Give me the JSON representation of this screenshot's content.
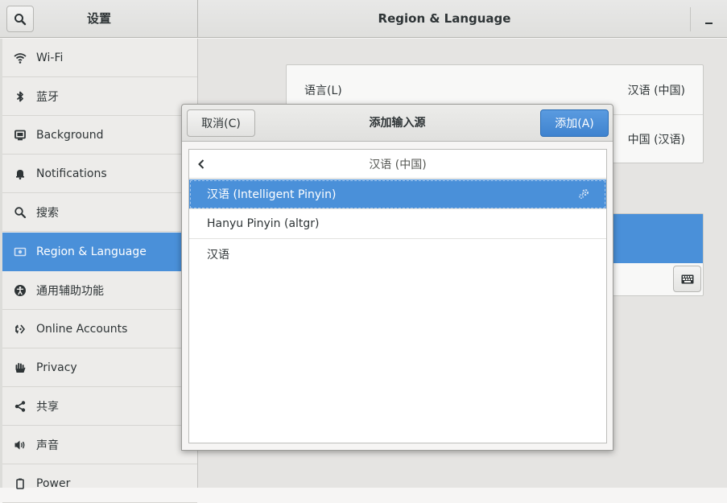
{
  "header": {
    "settings_title": "设置",
    "panel_title": "Region & Language"
  },
  "sidebar": {
    "items": [
      {
        "label": "Wi-Fi",
        "icon": "wifi-icon"
      },
      {
        "label": "蓝牙",
        "icon": "bluetooth-icon"
      },
      {
        "label": "Background",
        "icon": "display-icon"
      },
      {
        "label": "Notifications",
        "icon": "bell-icon"
      },
      {
        "label": "搜索",
        "icon": "search-icon"
      },
      {
        "label": "Region & Language",
        "icon": "flag-icon"
      },
      {
        "label": "通用辅助功能",
        "icon": "accessibility-icon"
      },
      {
        "label": "Online Accounts",
        "icon": "online-accounts-icon"
      },
      {
        "label": "Privacy",
        "icon": "hand-icon"
      },
      {
        "label": "共享",
        "icon": "share-icon"
      },
      {
        "label": "声音",
        "icon": "speaker-icon"
      },
      {
        "label": "Power",
        "icon": "power-icon"
      }
    ],
    "active_index": 5
  },
  "main": {
    "language_label": "语言(L)",
    "language_value": "汉语 (中国)",
    "formats_value": "中国 (汉语)"
  },
  "dialog": {
    "title": "添加输入源",
    "cancel_label": "取消(C)",
    "add_label": "添加(A)",
    "list_header": "汉语 (中国)",
    "rows": [
      {
        "label": "汉语 (Intelligent Pinyin)",
        "selected": true
      },
      {
        "label": "Hanyu Pinyin (altgr)",
        "selected": false
      },
      {
        "label": "汉语",
        "selected": false
      }
    ]
  },
  "colors": {
    "accent": "#4a90d9",
    "sidebar_bg": "#edecea",
    "text": "#2e3436"
  }
}
